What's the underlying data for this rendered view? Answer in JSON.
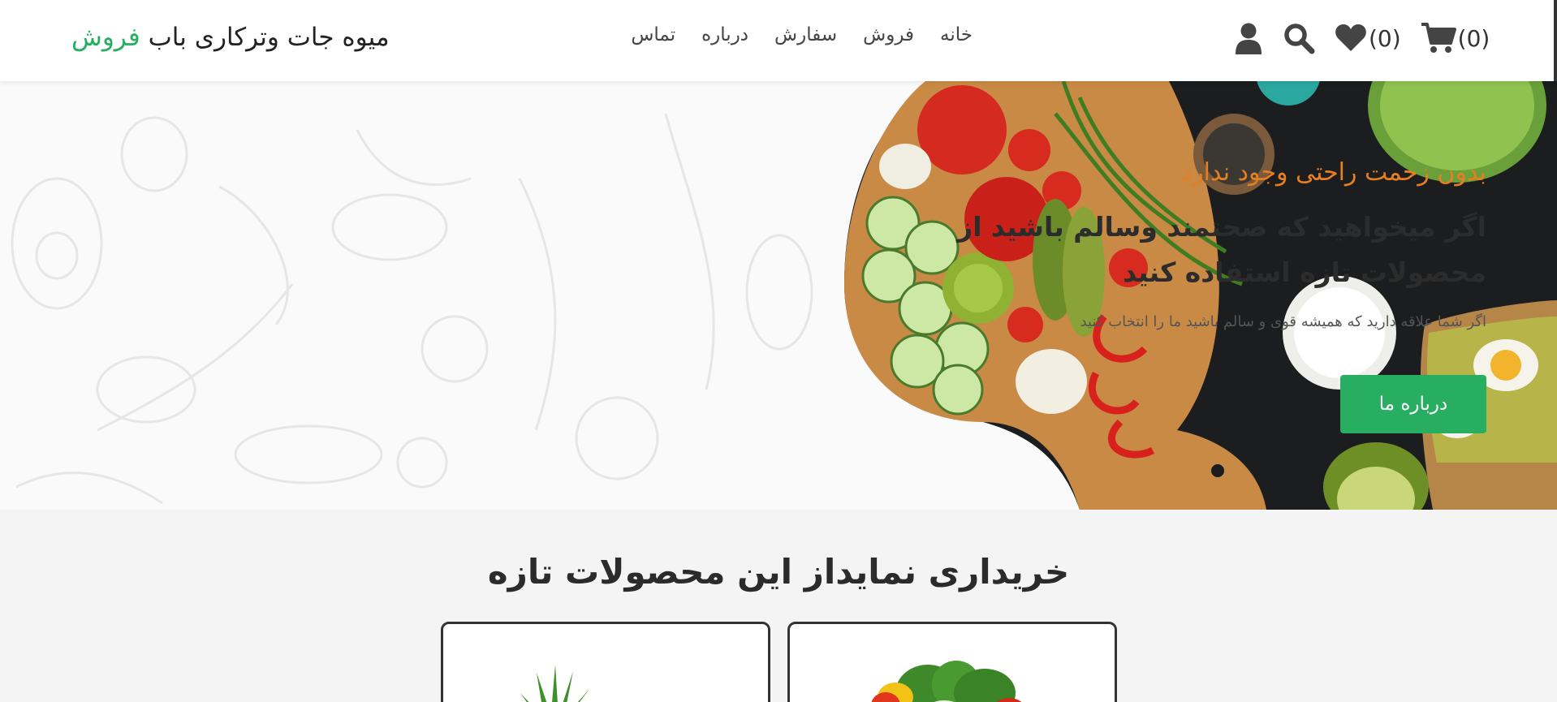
{
  "header": {
    "brand_main": "میوه جات وترکاری باب ",
    "brand_accent": "فروش",
    "nav": [
      "خانه",
      "فروش",
      "سفارش",
      "درباره",
      "تماس"
    ],
    "wishlist_count": "(0)",
    "cart_count": "(0)"
  },
  "icons": {
    "user": "user-icon",
    "search": "search-icon",
    "wishlist": "heart-icon",
    "cart": "cart-icon"
  },
  "hero": {
    "tag": "بدون زحمت راحتی وجود ندارد",
    "title": "اگر میخواهید که صحتمند وسالم باشید از محصولات تازه استفاده کنید",
    "desc": "اگر شما علاقه دارید که همیشه قوی و سالم باشید ما را انتخاب کنید",
    "button": "درباره ما"
  },
  "products": {
    "title": "خریداری نمایداز این محصولات تازه"
  },
  "colors": {
    "accent": "#27ae60",
    "tag": "#e67e22"
  }
}
